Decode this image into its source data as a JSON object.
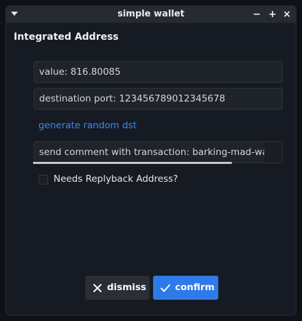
{
  "window": {
    "title": "simple wallet",
    "minimize_label": "−",
    "maximize_label": "+",
    "close_label": "×"
  },
  "section": {
    "title": "Integrated Address"
  },
  "fields": {
    "value": "value: 816.80085",
    "destination_port": "destination port: 123456789012345678",
    "comment": "send comment with transaction: barking-mad-wa"
  },
  "links": {
    "generate_random_dst": "generate random dst"
  },
  "checkbox": {
    "label": "Needs Replyback Address?",
    "checked": false
  },
  "buttons": {
    "dismiss": "dismiss",
    "confirm": "confirm"
  },
  "icons": {
    "menu": "chevron-down-icon",
    "dismiss": "close-icon",
    "confirm": "checkmark-icon"
  },
  "colors": {
    "accent": "#2e7ae8",
    "link": "#3a8cf2",
    "background": "#161a23"
  }
}
